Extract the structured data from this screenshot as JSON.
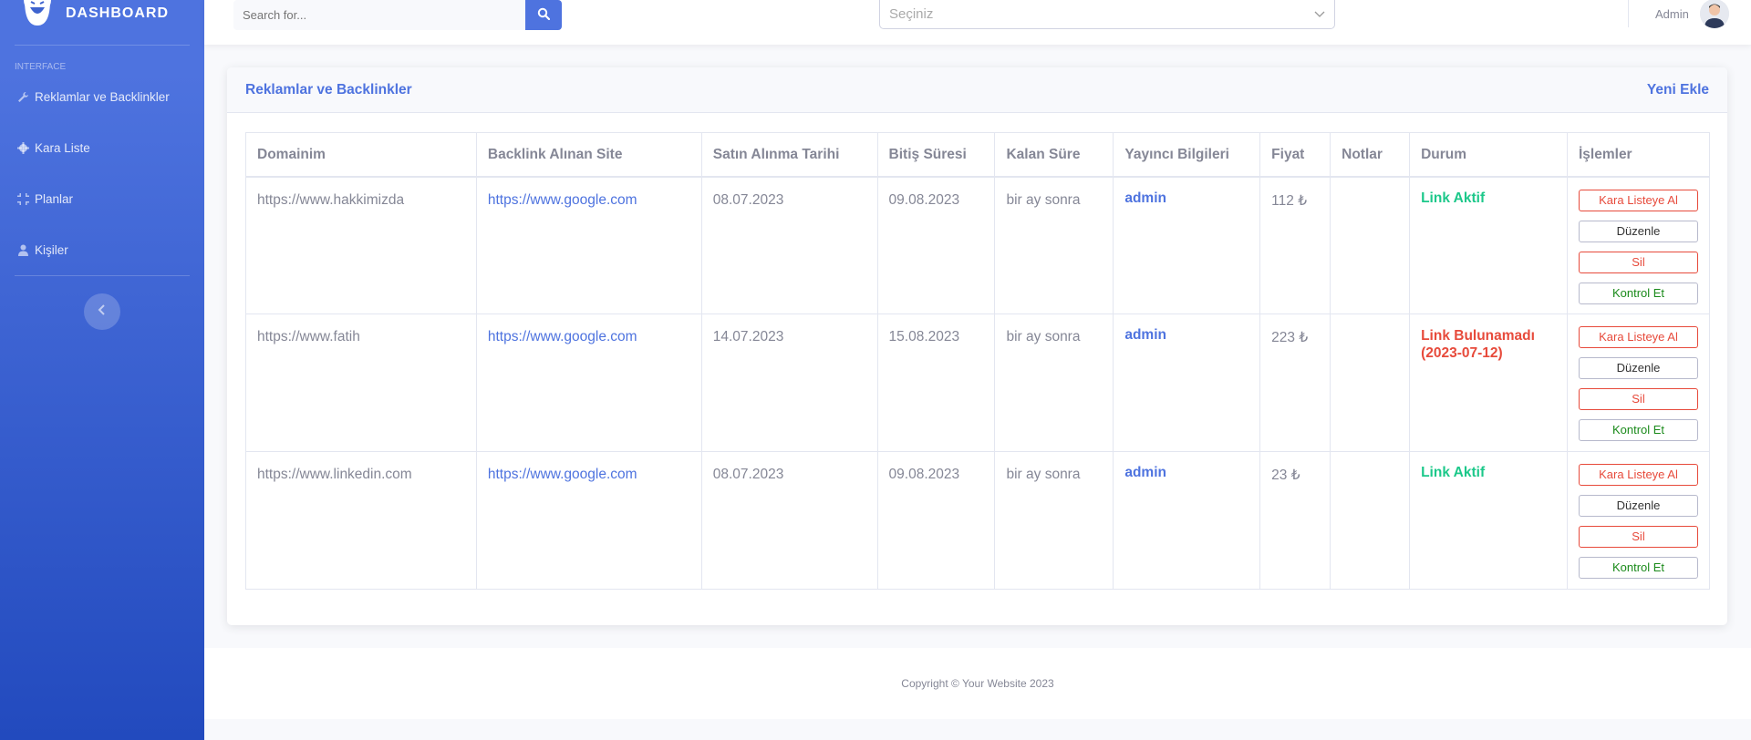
{
  "brand": {
    "title": "DASHBOARD",
    "icon": "laughing-face-icon"
  },
  "sidebar": {
    "heading": "INTERFACE",
    "items": [
      {
        "label": "Reklamlar ve Backlinkler",
        "icon": "wrench-icon"
      },
      {
        "label": "Kara Liste",
        "icon": "gear-icon"
      },
      {
        "label": "Planlar",
        "icon": "compress-icon"
      },
      {
        "label": "Kişiler",
        "icon": "user-icon"
      }
    ],
    "toggle_icon": "chevron-left-icon"
  },
  "topbar": {
    "search_placeholder": "Search for...",
    "select_placeholder": "Seçiniz",
    "user_name": "Admin"
  },
  "card": {
    "title": "Reklamlar ve Backlinkler",
    "action": "Yeni Ekle"
  },
  "table": {
    "headers": [
      "Domainim",
      "Backlink Alınan Site",
      "Satın Alınma Tarihi",
      "Bitiş Süresi",
      "Kalan Süre",
      "Yayıncı Bilgileri",
      "Fiyat",
      "Notlar",
      "Durum",
      "İşlemler"
    ],
    "rows": [
      {
        "domain": "https://www.hakkimizda",
        "site": "https://www.google.com",
        "bought": "08.07.2023",
        "ends": "09.08.2023",
        "remaining": "bir ay sonra",
        "publisher": "admin",
        "price": "112 ₺",
        "notes": "",
        "status": "Link Aktif",
        "status_type": "ok"
      },
      {
        "domain": "https://www.fatih",
        "site": "https://www.google.com",
        "bought": "14.07.2023",
        "ends": "15.08.2023",
        "remaining": "bir ay sonra",
        "publisher": "admin",
        "price": "223 ₺",
        "notes": "",
        "status": "Link Bulunamadı (2023-07-12)",
        "status_type": "bad"
      },
      {
        "domain": "https://www.linkedin.com",
        "site": "https://www.google.com",
        "bought": "08.07.2023",
        "ends": "09.08.2023",
        "remaining": "bir ay sonra",
        "publisher": "admin",
        "price": "23 ₺",
        "notes": "",
        "status": "Link Aktif",
        "status_type": "ok"
      }
    ],
    "actions": {
      "blacklist": "Kara Listeye Al",
      "edit": "Düzenle",
      "delete": "Sil",
      "check": "Kontrol Et"
    }
  },
  "footer": {
    "text": "Copyright © Your Website 2023"
  },
  "colors": {
    "primary": "#4e73df",
    "success": "#1cc88a",
    "danger": "#e74a3b"
  }
}
